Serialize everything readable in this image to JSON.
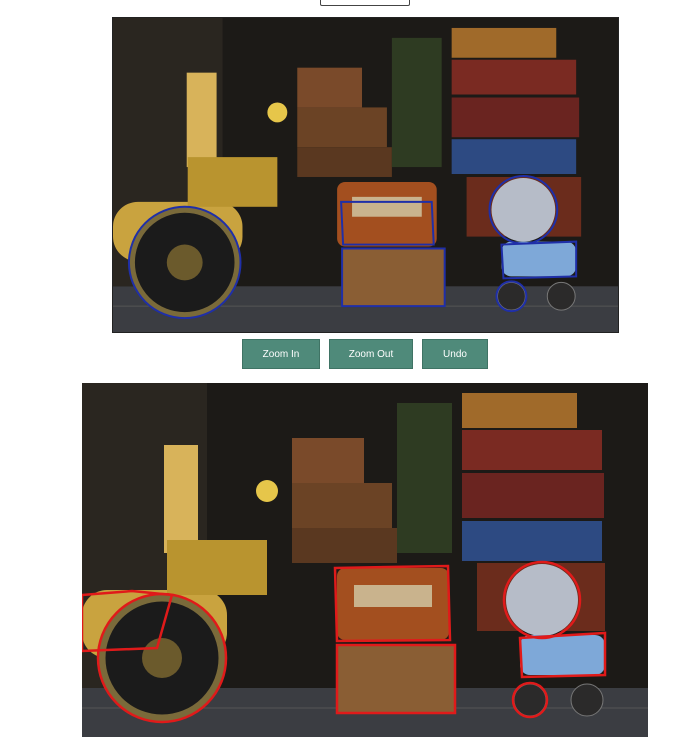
{
  "controls": {
    "zoom_in_label": "Zoom In",
    "zoom_out_label": "Zoom Out",
    "undo_label": "Undo"
  },
  "images": {
    "top": {
      "outline_color": "#1f2fa8"
    },
    "bottom": {
      "outline_color": "#e01a1a"
    }
  }
}
